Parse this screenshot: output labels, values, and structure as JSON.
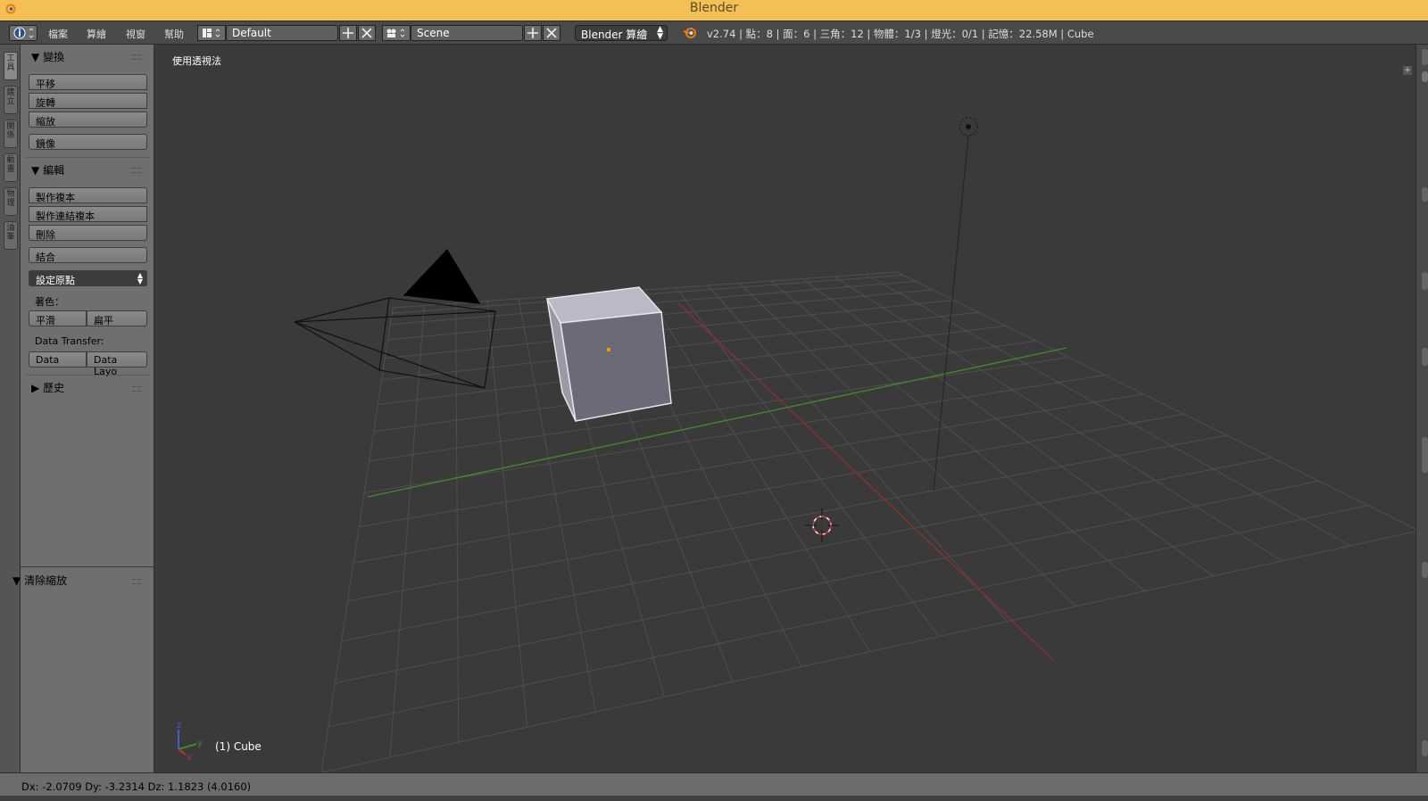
{
  "window": {
    "title": "Blender"
  },
  "menu": {
    "items": [
      "檔案",
      "算繪",
      "視窗",
      "幫助"
    ]
  },
  "header": {
    "screen_layout": "Default",
    "scene": "Scene",
    "render_engine": "Blender 算繪",
    "stats": "v2.74 | 點：8 | 面：6 | 三角：12 | 物體：1/3 | 燈光：0/1 | 記憶：22.58M | Cube"
  },
  "left_tabs": [
    "工具",
    "建立",
    "關係",
    "動畫",
    "物理",
    "油筆"
  ],
  "toolshelf": {
    "transform": {
      "title": "變換",
      "buttons": [
        "平移",
        "旋轉",
        "縮放",
        "鏡像"
      ]
    },
    "edit": {
      "title": "編輯",
      "buttons": [
        "製作複本",
        "製作連結複本",
        "刪除",
        "結合"
      ],
      "set_origin": "設定原點",
      "shading_label": "著色：",
      "shading_smooth": "平滑",
      "shading_flat": "扁平",
      "data_transfer_label": "Data Transfer:",
      "data_btn": "Data",
      "data_layout_btn": "Data Layo"
    },
    "history": {
      "title": "歷史"
    },
    "operator": {
      "title": "清除縮放"
    }
  },
  "viewport": {
    "perspective_label": "使用透視法",
    "active_object": "(1) Cube",
    "axis_x": "x",
    "axis_y": "y",
    "axis_z": "z"
  },
  "statusbar": {
    "text": "Dx: -2.0709  Dy: -3.2314  Dz: 1.1823 (4.0160)"
  },
  "colors": {
    "titlebar": "#f2c055",
    "header": "#4a4a4a",
    "toolshelf": "#6f6f6f",
    "viewport": "#3a3a3a",
    "grid": "#4e4e4e",
    "x_axis": "#9a3434",
    "y_axis": "#3f8a2a",
    "cube_top": "#b9b9c8",
    "cube_front": "#6a6a78"
  },
  "icons": [
    "blender-logo-icon",
    "info-editor-icon",
    "screen-layout-icon",
    "scene-icon",
    "add-icon",
    "close-icon",
    "render-engine-icon"
  ]
}
